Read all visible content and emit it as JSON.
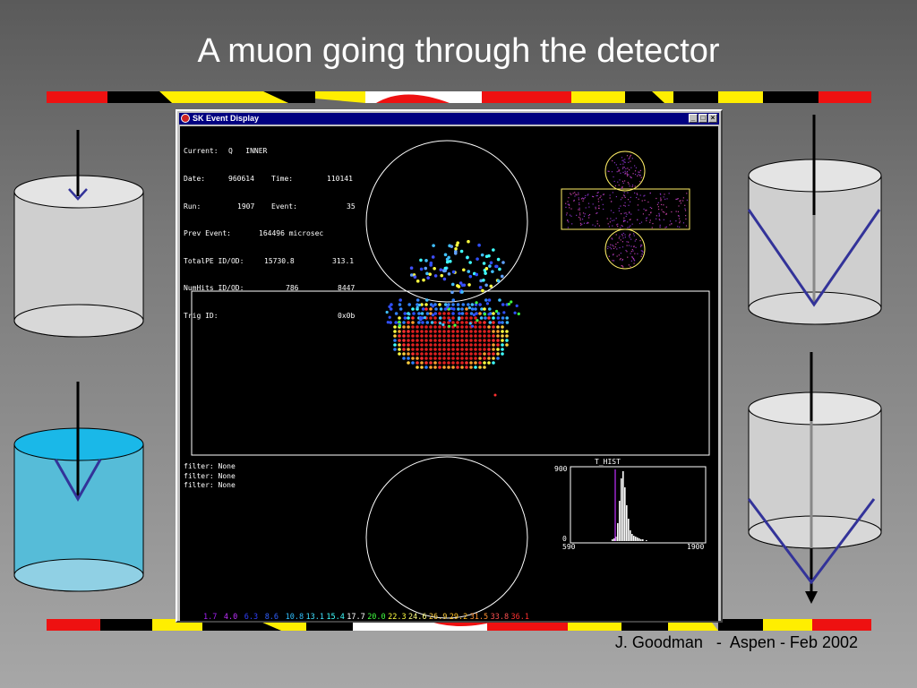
{
  "slide": {
    "title": "A muon going through the detector",
    "footer": "J. Goodman   -  Aspen - Feb 2002"
  },
  "colors": {
    "stripe_red": "#ee1111",
    "stripe_yellow": "#ffee00",
    "stripe_black": "#000000",
    "stripe_white": "#ffffff",
    "cylinder_fill": "#d0d0d0",
    "water_fill": "#38b7d8",
    "cone_line": "#333399"
  },
  "window": {
    "title": "SK Event Display",
    "controls": {
      "minimize": "_",
      "maximize": "□",
      "close": "×"
    },
    "info": {
      "current_label": "Current:",
      "current_value": "Q   INNER",
      "date_label": "Date:",
      "date_value": "960614",
      "time_label": "Time:",
      "time_value": "110141",
      "run_label": "Run:",
      "run_value": "1907",
      "event_label": "Event:",
      "event_value": "35",
      "prev_label": "Prev Event:",
      "prev_value": "164496 microsec",
      "totalpe_label": "TotalPE ID/OD:",
      "totalpe_id": "15730.8",
      "totalpe_od": "313.1",
      "numhits_label": "NumHits ID/OD:",
      "numhits_id": "786",
      "numhits_od": "8447",
      "trig_label": "Trig ID:",
      "trig_value": "0x0b"
    },
    "filters": [
      "filter: None",
      "filter: None",
      "filter: None"
    ],
    "histogram": {
      "title": "T_HIST",
      "y_max": "900",
      "y_min": "0",
      "x_min": "590",
      "x_max": "1900"
    },
    "scale": {
      "values": [
        "1.7",
        "4.0",
        "6.3",
        "8.6",
        "10.8",
        "13.1",
        "15.4",
        "17.7",
        "20.0",
        "22.3",
        "24.6",
        "26.9",
        "29.2",
        "31.5",
        "33.8",
        "36.1"
      ],
      "colors": [
        "#a020f0",
        "#c030ff",
        "#3040ff",
        "#3060ff",
        "#30c0ff",
        "#40e0ff",
        "#40ffff",
        "#ffffff",
        "#40ff40",
        "#ffff40",
        "#ffff80",
        "#ffd040",
        "#ffc020",
        "#ff9030",
        "#ff5050",
        "#ff3030"
      ]
    }
  }
}
